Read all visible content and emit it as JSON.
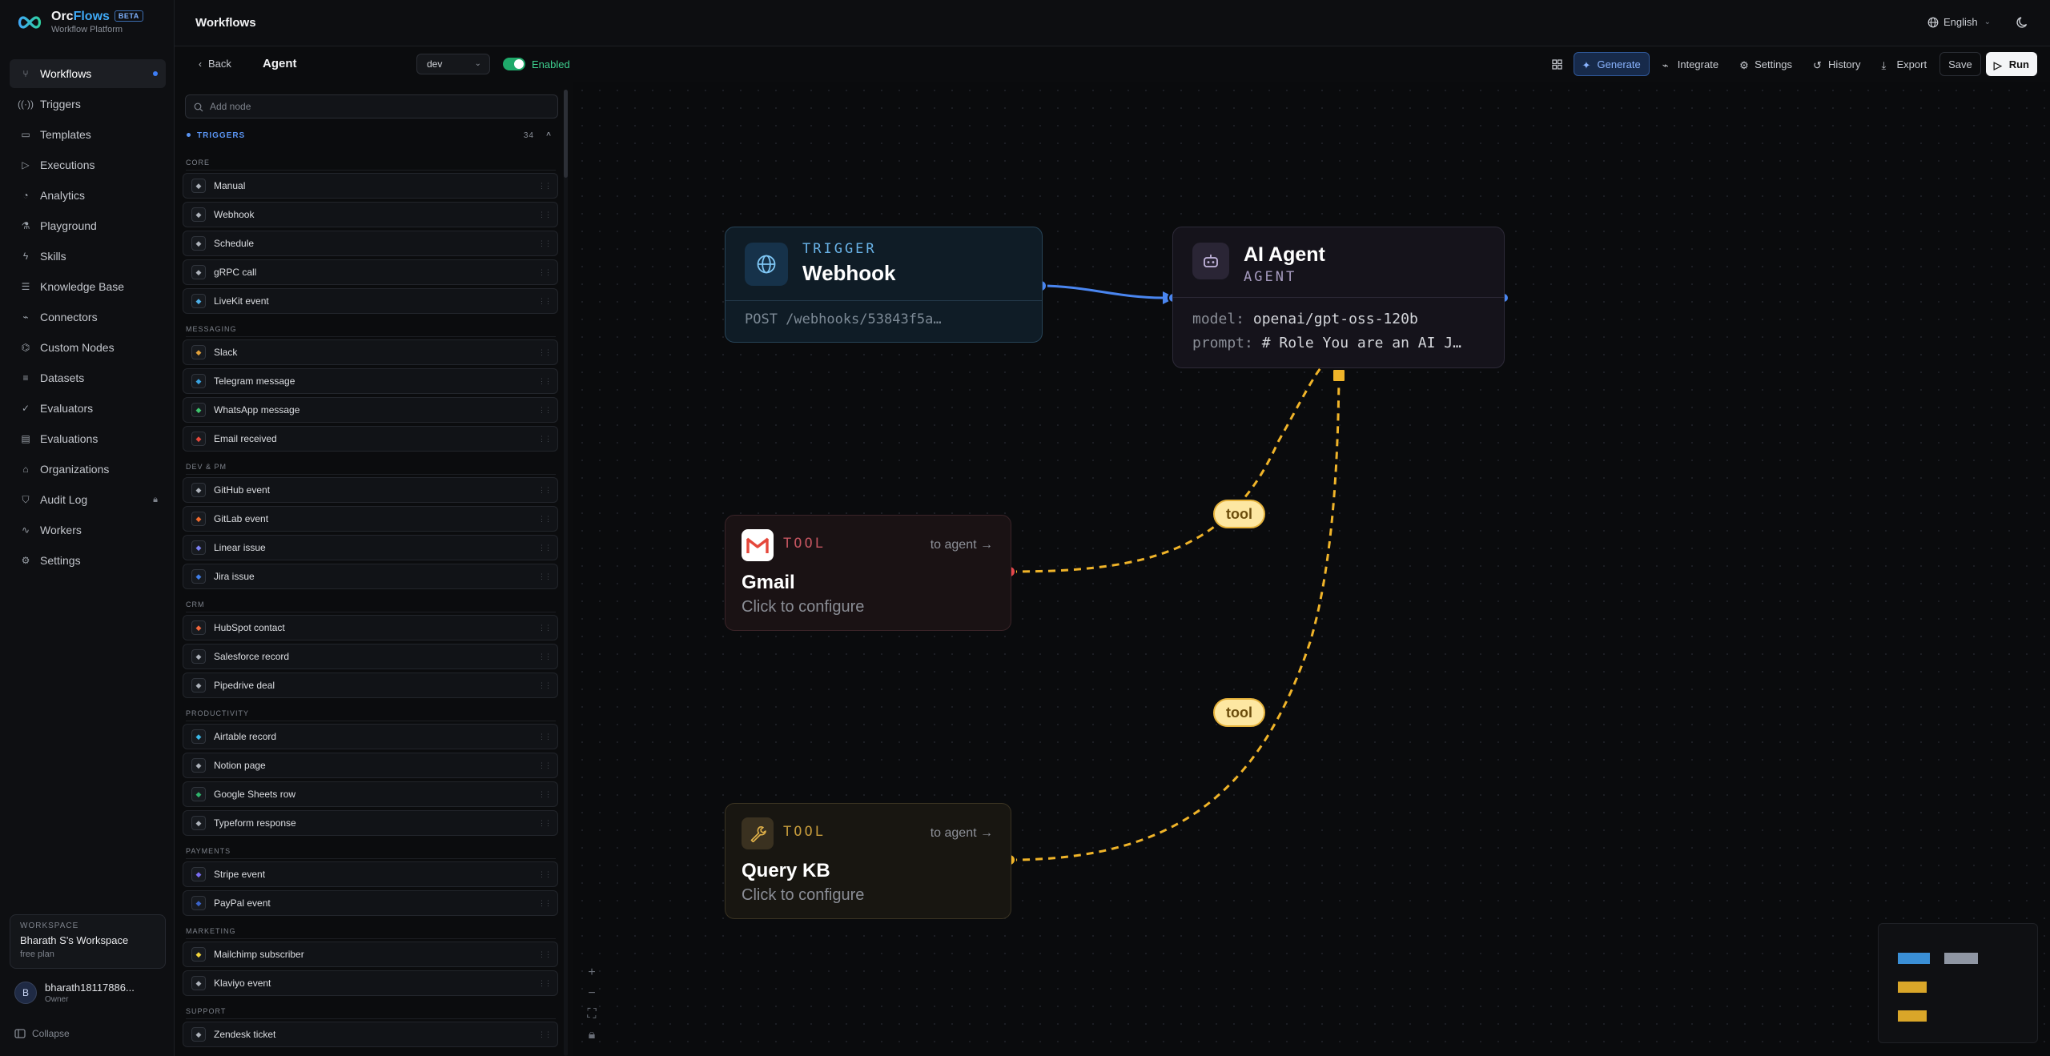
{
  "brand": {
    "name_a": "Orc",
    "name_b": "Flows",
    "badge": "BETA",
    "subtitle": "Workflow Platform"
  },
  "nav": [
    {
      "label": "Workflows",
      "icon": "workflow-icon",
      "active": true
    },
    {
      "label": "Triggers",
      "icon": "radio-icon"
    },
    {
      "label": "Templates",
      "icon": "file-icon"
    },
    {
      "label": "Executions",
      "icon": "play-icon"
    },
    {
      "label": "Analytics",
      "icon": "chart-icon"
    },
    {
      "label": "Playground",
      "icon": "flask-icon"
    },
    {
      "label": "Skills",
      "icon": "bolt-icon"
    },
    {
      "label": "Knowledge Base",
      "icon": "database-icon"
    },
    {
      "label": "Connectors",
      "icon": "plug-icon"
    },
    {
      "label": "Custom Nodes",
      "icon": "code-icon"
    },
    {
      "label": "Datasets",
      "icon": "list-icon"
    },
    {
      "label": "Evaluators",
      "icon": "check-icon"
    },
    {
      "label": "Evaluations",
      "icon": "clipboard-icon"
    },
    {
      "label": "Organizations",
      "icon": "users-icon"
    },
    {
      "label": "Audit Log",
      "icon": "shield-icon",
      "locked": true
    },
    {
      "label": "Workers",
      "icon": "activity-icon"
    },
    {
      "label": "Settings",
      "icon": "gear-icon"
    }
  ],
  "workspace": {
    "label": "WORKSPACE",
    "name": "Bharath S's Workspace",
    "plan": "free plan"
  },
  "user": {
    "initial": "B",
    "name": "bharath18117886...",
    "role": "Owner"
  },
  "collapse_label": "Collapse",
  "header": {
    "title": "Workflows",
    "language": "English"
  },
  "toolbar": {
    "back": "Back",
    "workflow_name": "Agent",
    "env": "dev",
    "enabled_label": "Enabled",
    "generate": "Generate",
    "integrate": "Integrate",
    "settings": "Settings",
    "history": "History",
    "export": "Export",
    "save": "Save",
    "run": "Run"
  },
  "palette": {
    "search_placeholder": "Add node",
    "group": "TRIGGERS",
    "group_count": "34",
    "categories": [
      {
        "name": "CORE",
        "items": [
          {
            "label": "Manual",
            "icon": "hand-icon",
            "color": "#aeb3bb"
          },
          {
            "label": "Webhook",
            "icon": "webhook-icon",
            "color": "#aeb3bb"
          },
          {
            "label": "Schedule",
            "icon": "clock-icon",
            "color": "#aeb3bb"
          },
          {
            "label": "gRPC call",
            "icon": "grpc-icon",
            "color": "#aeb3bb"
          },
          {
            "label": "LiveKit event",
            "icon": "livekit-icon",
            "color": "#4fb0e8"
          }
        ]
      },
      {
        "name": "MESSAGING",
        "items": [
          {
            "label": "Slack",
            "icon": "slack-icon",
            "color": "#e0a03a"
          },
          {
            "label": "Telegram message",
            "icon": "telegram-icon",
            "color": "#3aa3e0"
          },
          {
            "label": "WhatsApp message",
            "icon": "whatsapp-icon",
            "color": "#3ec46d"
          },
          {
            "label": "Email received",
            "icon": "gmail-icon",
            "color": "#e5473b"
          }
        ]
      },
      {
        "name": "DEV & PM",
        "items": [
          {
            "label": "GitHub event",
            "icon": "github-icon",
            "color": "#aeb3bb"
          },
          {
            "label": "GitLab event",
            "icon": "gitlab-icon",
            "color": "#f06a2d"
          },
          {
            "label": "Linear issue",
            "icon": "linear-icon",
            "color": "#7a7ff2"
          },
          {
            "label": "Jira issue",
            "icon": "jira-icon",
            "color": "#3f7ee8"
          }
        ]
      },
      {
        "name": "CRM",
        "items": [
          {
            "label": "HubSpot contact",
            "icon": "hubspot-icon",
            "color": "#f2663b"
          },
          {
            "label": "Salesforce record",
            "icon": "salesforce-icon",
            "color": "#aeb3bb"
          },
          {
            "label": "Pipedrive deal",
            "icon": "pipedrive-icon",
            "color": "#aeb3bb"
          }
        ]
      },
      {
        "name": "PRODUCTIVITY",
        "items": [
          {
            "label": "Airtable record",
            "icon": "airtable-icon",
            "color": "#3bb8e8"
          },
          {
            "label": "Notion page",
            "icon": "notion-icon",
            "color": "#aeb3bb"
          },
          {
            "label": "Google Sheets row",
            "icon": "sheets-icon",
            "color": "#2fb36b"
          },
          {
            "label": "Typeform response",
            "icon": "typeform-icon",
            "color": "#aeb3bb"
          }
        ]
      },
      {
        "name": "PAYMENTS",
        "items": [
          {
            "label": "Stripe event",
            "icon": "stripe-icon",
            "color": "#7a6cf2"
          },
          {
            "label": "PayPal event",
            "icon": "paypal-icon",
            "color": "#3a63c8"
          }
        ]
      },
      {
        "name": "MARKETING",
        "items": [
          {
            "label": "Mailchimp subscriber",
            "icon": "mailchimp-icon",
            "color": "#f2d33b"
          },
          {
            "label": "Klaviyo event",
            "icon": "klaviyo-icon",
            "color": "#aeb3bb"
          }
        ]
      },
      {
        "name": "SUPPORT",
        "items": [
          {
            "label": "Zendesk ticket",
            "icon": "zendesk-icon",
            "color": "#aeb3bb"
          }
        ]
      }
    ]
  },
  "canvas": {
    "webhook": {
      "tag": "TRIGGER",
      "title": "Webhook",
      "body": "POST /webhooks/53843f5a…"
    },
    "agent": {
      "title": "AI Agent",
      "tag": "AGENT",
      "model_key": "model:",
      "model_val": "openai/gpt-oss-120b",
      "prompt_key": "prompt:",
      "prompt_val": "# Role You are an AI J…"
    },
    "gmail": {
      "tag": "TOOL",
      "to_agent": "to agent →",
      "title": "Gmail",
      "sub": "Click to configure"
    },
    "kb": {
      "tag": "TOOL",
      "to_agent": "to agent →",
      "title": "Query KB",
      "sub": "Click to configure"
    },
    "edge_label": "tool",
    "colors": {
      "trigger_edge": "#4a86f0",
      "tool_edge": "#f0b429",
      "gmail_handle": "#e5474b"
    }
  }
}
